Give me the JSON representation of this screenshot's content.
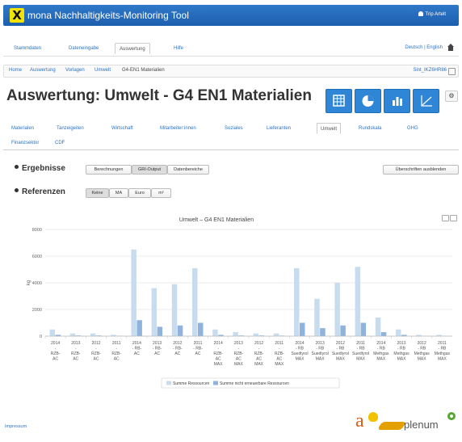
{
  "header": {
    "app_title": "mona Nachhaltigkeits-Monitoring Tool",
    "logo_letter": "X",
    "user_name": "Trip Artelt"
  },
  "menu": {
    "items": [
      {
        "label": "Stammdaten"
      },
      {
        "label": "Dateneingabe"
      },
      {
        "label": "Auswertung"
      },
      {
        "label": "Hilfe"
      }
    ],
    "language": "Deutsch | English"
  },
  "breadcrumb": {
    "items": [
      "Home",
      "Auswertung",
      "Vorlagen",
      "Umwelt",
      "G4-EN1 Materialien"
    ],
    "user_id": "Sint_IKZ6HR86"
  },
  "page": {
    "title": "Auswertung: Umwelt - G4 EN1 Materialien"
  },
  "tabs": [
    {
      "label": "Materialen"
    },
    {
      "label": "Tanzeigeiten"
    },
    {
      "label": "Wirtschaft"
    },
    {
      "label": "Mitarbeiter:innen"
    },
    {
      "label": "Soziales"
    },
    {
      "label": "Lieferanten"
    },
    {
      "label": "Umwelt"
    },
    {
      "label": "Rundskala"
    },
    {
      "label": "GHG"
    },
    {
      "label": "Finanzsektor"
    },
    {
      "label": "CDF"
    }
  ],
  "results": {
    "label": "Ergebnisse",
    "buttons": [
      "Berechnungen",
      "GRI-Output",
      "Datenbereiche"
    ],
    "active": "GRI-Output",
    "hide_headings": "Überschriften ausblenden"
  },
  "references": {
    "label": "Referenzen",
    "buttons": [
      "Keine",
      "MA",
      "Euro",
      "m²"
    ],
    "active": "Keine"
  },
  "footer": {
    "impressum": "Impressum",
    "brand_a": "a",
    "brand_plenum": "plenum"
  },
  "chart_data": {
    "type": "bar",
    "title": "Umwelt – G4 EN1 Materialien",
    "ylabel": "kg",
    "ylim": [
      0,
      8000
    ],
    "yticks": [
      0,
      2000,
      4000,
      6000,
      8000
    ],
    "grid": true,
    "legend_position": "bottom",
    "categories": [
      [
        "2014",
        "-",
        "RZB-",
        "AC"
      ],
      [
        "2013",
        "-",
        "RZB-",
        "AC"
      ],
      [
        "2012",
        "-",
        "RZB-",
        "AC"
      ],
      [
        "2011",
        "-",
        "RZB-",
        "AC"
      ],
      [
        "2014",
        "- RB-",
        "AC"
      ],
      [
        "2013",
        "- RB-",
        "AC"
      ],
      [
        "2012",
        "- RB-",
        "AC"
      ],
      [
        "2011",
        "- RB-",
        "AC"
      ],
      [
        "2014",
        "-",
        "RZB-",
        "AC",
        "MAX"
      ],
      [
        "2013",
        "-",
        "RZB-",
        "AC",
        "MAX"
      ],
      [
        "2012",
        "-",
        "RZB-",
        "AC",
        "MAX"
      ],
      [
        "2011",
        "-",
        "RZB-",
        "AC",
        "MAX"
      ],
      [
        "2014",
        "- RB",
        "Suedtyrol",
        "MAX"
      ],
      [
        "2013",
        "- RB",
        "Suedtyrol",
        "MAX"
      ],
      [
        "2012",
        "- RB",
        "Suedtyrol",
        "MAX"
      ],
      [
        "2011",
        "- RB",
        "Suedtyrol",
        "MAX"
      ],
      [
        "2014",
        "- RB",
        "Methgas",
        "MAX"
      ],
      [
        "2013",
        "- RB",
        "Methgas",
        "MAX"
      ],
      [
        "2012",
        "- RB",
        "Methgas",
        "MAX"
      ],
      [
        "2011",
        "- RB",
        "Methgas",
        "MAX"
      ]
    ],
    "series": [
      {
        "name": "Summe Ressourcen",
        "color": "#c7dcef",
        "values": [
          500,
          200,
          200,
          100,
          6500,
          3600,
          3900,
          5100,
          500,
          300,
          200,
          200,
          5100,
          2800,
          4000,
          5200,
          1400,
          500,
          100,
          100
        ]
      },
      {
        "name": "Summe nicht erneuerbare Ressourcen",
        "color": "#8fb3dc",
        "values": [
          100,
          50,
          50,
          30,
          1200,
          700,
          800,
          1000,
          100,
          50,
          50,
          40,
          1000,
          600,
          800,
          1000,
          300,
          100,
          20,
          20
        ]
      }
    ]
  }
}
